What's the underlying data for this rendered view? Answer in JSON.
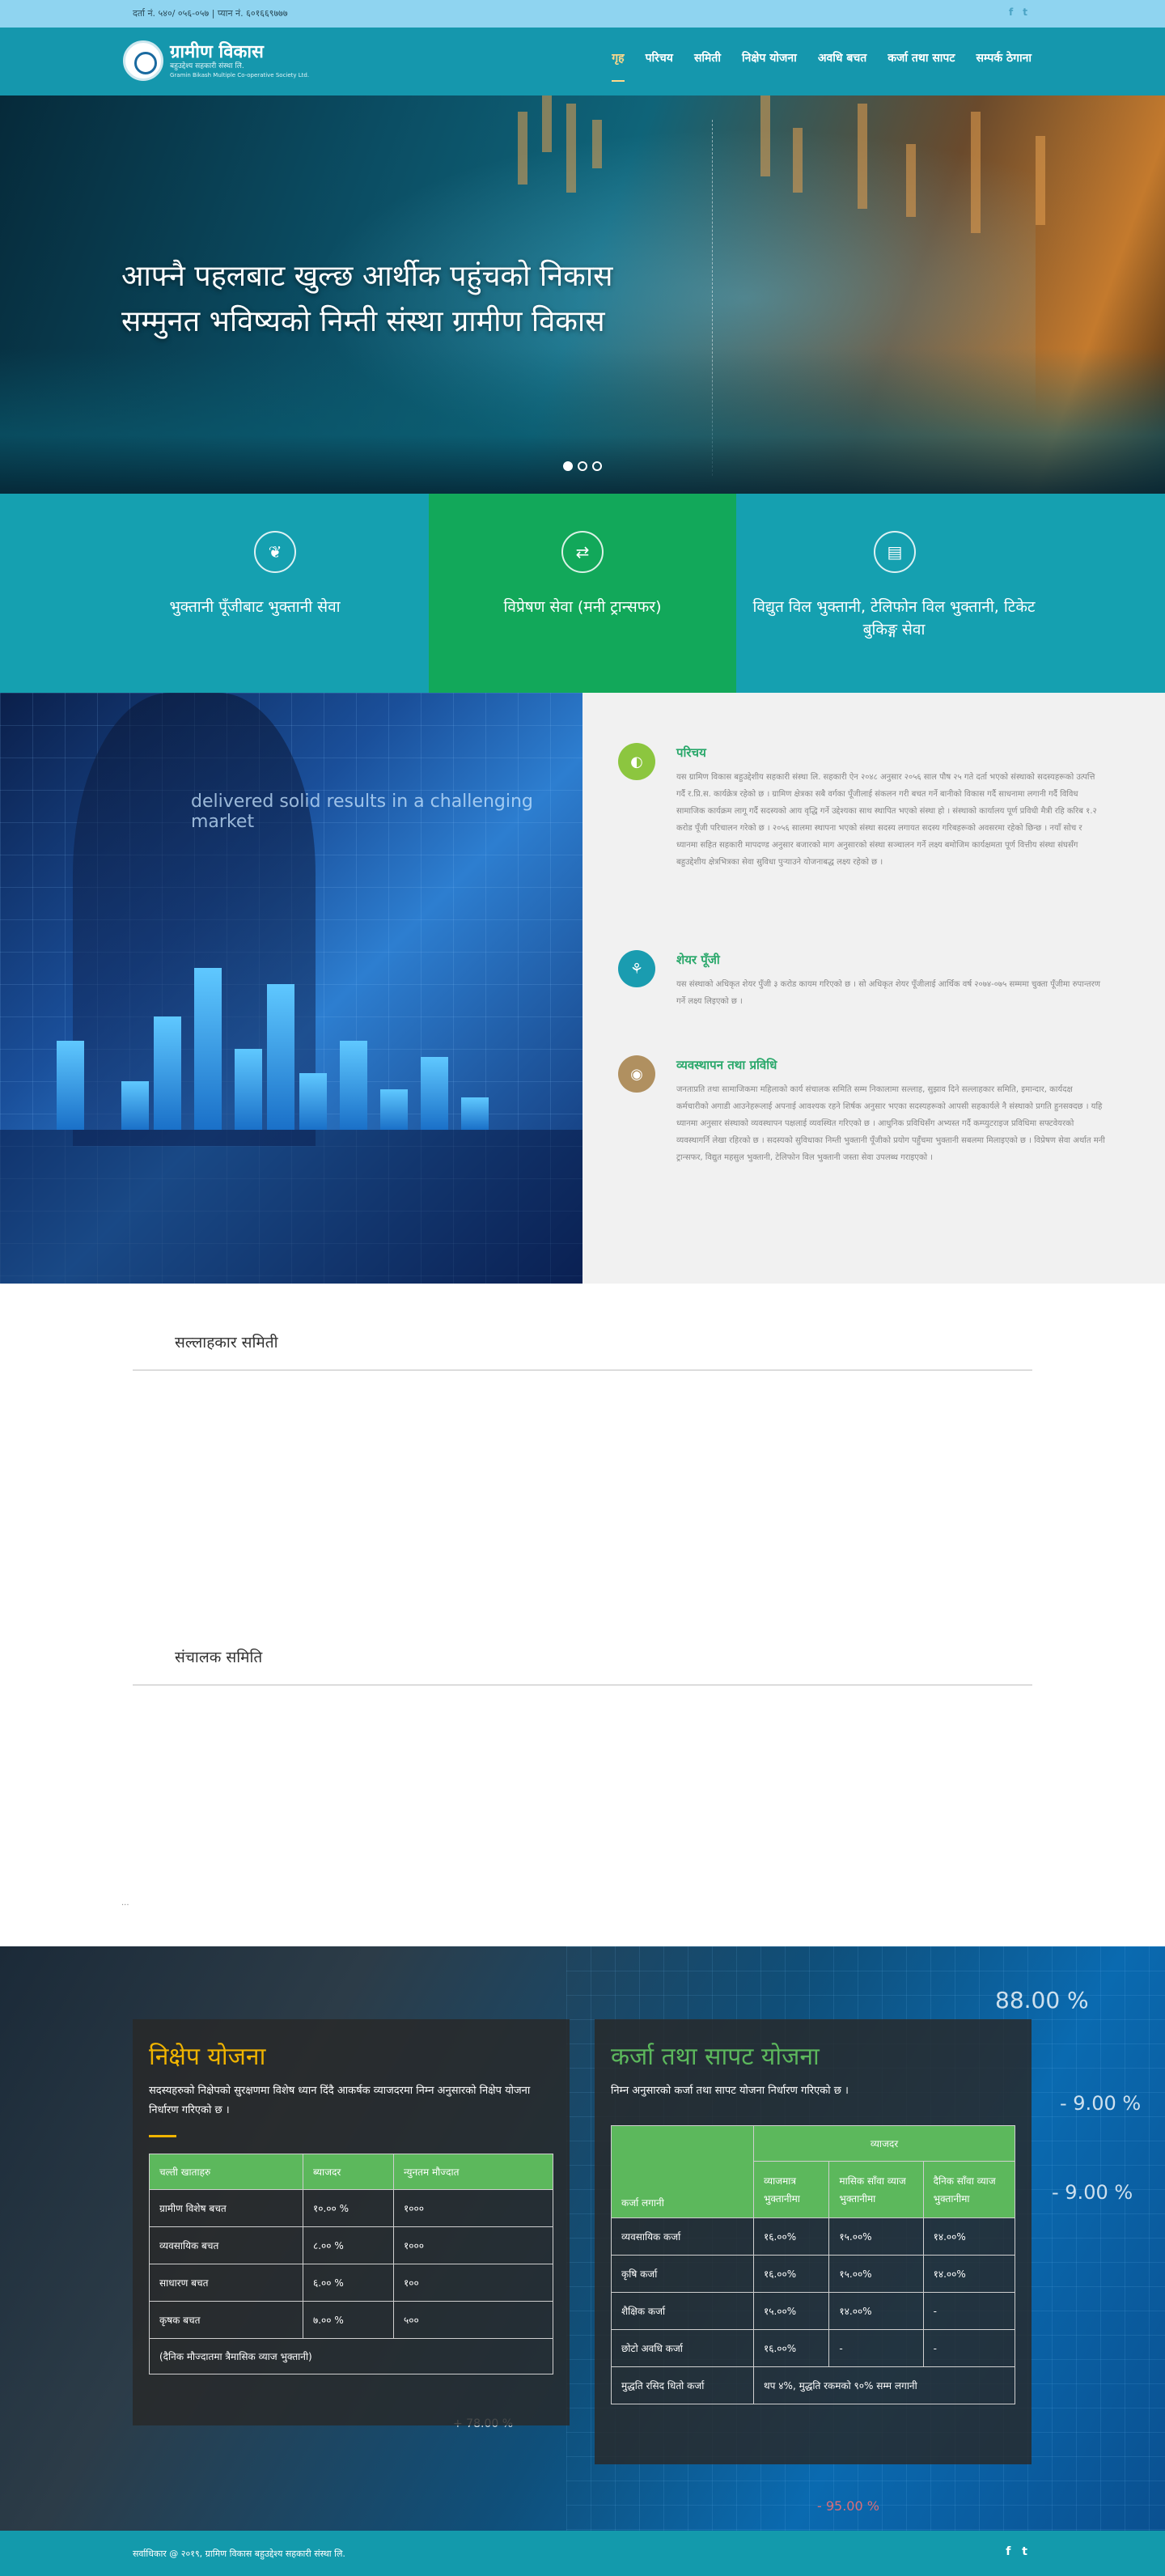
{
  "topbar": {
    "registration": "दर्ता नं. ५४०/ ०५६-०५७ | प्यान नं. ६०१६६९७७७",
    "social": [
      "f",
      "t"
    ]
  },
  "brand": {
    "name": "ग्रामीण विकास",
    "subtitle": "बहुउद्देश्य सहकारी संस्था लि.",
    "subtitle_en": "Gramin Bikash Multiple Co-operative Society Ltd."
  },
  "nav": {
    "items": [
      "गृह",
      "परिचय",
      "समिती",
      "निक्षेप योजना",
      "अवधि बचत",
      "कर्जा तथा सापट",
      "सम्पर्क ठेगाना"
    ],
    "active_index": 0
  },
  "hero": {
    "line1": "आफ्नै पहलबाट खुल्छ आर्थीक पहुंचको निकास",
    "line2": "सम्मुनत भविष्यको निम्ती संस्था ग्रामीण विकास"
  },
  "services": [
    {
      "title": "भुक्तानी पूँजीबाट भुक्तानी सेवा",
      "icon": "leaf-icon"
    },
    {
      "title": "विप्रेषण सेवा (मनी ट्रान्सफर)",
      "icon": "money-transfer-icon"
    },
    {
      "title": "विद्युत विल भुक्तानी, टेलिफोन विल भुक्तानी, टिकेट बुकिङ्ग सेवा",
      "icon": "bill-payment-icon"
    }
  ],
  "about_image": {
    "headline": "delivered solid results in a challenging market"
  },
  "about": [
    {
      "title": "परिचय",
      "icon": "info-icon",
      "color": "#8cc63f",
      "text": "यस ग्रामिण विकास बहुउद्देशीय सहकारी संस्था लि. सहकारी ऐन २०४८ अनुसार २०५६ साल पौष २५ गते दर्ता भएको संस्थाको सदस्यहरूको उत्पत्ति गर्दै र.प्रि.स. कार्यक्रेत्र रहेको छ । ग्रामिण क्षेत्रका सबै वर्गका पूँजीलाई संकलन गरी बचत गर्ने बानीको विकास गर्दै साधनामा लगानी गर्दै विविध सामाजिक कार्यक्रम लागू गर्दै सदस्यको आय वृद्धि गर्ने उद्देश्यका साथ स्थापित भएको संस्था हो । संस्थाको कार्यालय पूर्ण प्रविधी मैत्री रहि करिब १.२ करोड पूँजी परिचालन गरेको छ । २०५६ सालमा स्थापना भएको संस्था सदस्य लगायत सदस्य गरिबहरूको अवसरमा रहेको छिन्छ । नयाँ सोच र ध्यानमा सहित सहकारी मापदण्ड अनुसार बजारको माग अनुसारको संस्था सञ्चालन गर्ने लक्ष्य बमोजिम कार्यक्षमता पूर्ण वित्तीय संस्था संघसँग बहुउद्देशीय क्षेत्रभित्रका सेवा सुविधा पुर्‍याउने योजनाबद्ध लक्ष्य रहेको छ ।"
    },
    {
      "title": "शेयर पूँजी",
      "icon": "share-capital-icon",
      "color": "#1a9cb0",
      "text": "यस संस्थाको अधिकृत शेयर पुँजी ३ करोड कायम गरिएको छ । सो अधिकृत शेयर पूँजीलाई आर्थिक वर्ष २०७४-०७५ सम्ममा चुक्ता पूँजीमा रुपान्तरण गर्ने लक्ष्य लिइएको छ ।"
    },
    {
      "title": "व्यवस्थापन तथा प्रविधि",
      "icon": "management-icon",
      "color": "#b09060",
      "text": "जनताप्रति तथा सामाजिकमा महिलाको कार्य संचालक समिति सम्म निकालामा सल्लाह, सुझाव दिने सल्लाहकार समिति, इमान्दार, कार्यदक्ष कर्मचारीको अगाडी आउनेहरूलाई अपनाई आवश्यक रहने शिर्षक अनुसार भएका सदस्यहरूको आपसी सहकार्यले नै संस्थाको प्रगति हुनसक्दछ । यहि ध्यानमा अनुसार संस्थाको व्यवस्थापन पक्षलाई व्यवस्थित गरिएको छ । आधुनिक प्रविधिसँग अभ्यस्त गर्दै कम्प्युटराइज प्रविधिमा सफ्टवेयरको व्यवस्थागर्नि लेखा रहिरको छ । सदस्यको सुविधाका निम्ती भुक्तानी पूँजीको प्रयोग पहुँचमा भुक्तानी सबलमा मिलाइएको छ । विप्रेषण सेवा अर्थात मनी ट्रान्सफर, विद्युत महसुल भुक्तानी, टेलिफोन विल भुक्तानी जस्ता सेवा उपलब्ध गराइएको ।"
    }
  ],
  "committees": {
    "advisory_title": "सल्लाहकार समिती",
    "board_title": "संचालक समिति",
    "trailing_mark": "..."
  },
  "deposit": {
    "title": "निक्षेप योजना",
    "intro": "सदस्यहरुको निक्षेपको सुरक्षणमा विशेष ध्यान दिंदै आकर्षक व्याजदरमा निम्न अनुसारको निक्षेप योजना निर्धारण गरिएको छ ।",
    "headers": [
      "चल्ती खाताहरु",
      "ब्याजदर",
      "न्युनतम मौज्दात"
    ],
    "rows": [
      [
        "ग्रामीण विशेष बचत",
        "१०.०० %",
        "१०००"
      ],
      [
        "व्यवसायिक बचत",
        "८.०० %",
        "१०००"
      ],
      [
        "साधारण बचत",
        "६.०० %",
        "१००"
      ],
      [
        "कृषक बचत",
        "७.०० %",
        "५००"
      ]
    ],
    "note": "(दैनिक मौज्दातमा त्रैमासिक व्याज भुक्तानी)"
  },
  "loan": {
    "title": "कर्जा तथा सापट योजना",
    "intro": "निम्न अनुसारको कर्जा तथा सापट योजना निर्धारण गरिएको छ ।",
    "col_loan": "कर्जा लगानी",
    "group_header": "व्याजदर",
    "sub_headers": [
      "व्याजमात्र भुक्तानीमा",
      "मासिक साँवा व्याज भुक्तानीमा",
      "दैनिक साँवा व्याज भुक्तानीमा"
    ],
    "rows": [
      [
        "व्यवसायिक कर्जा",
        "१६.००%",
        "१५.००%",
        "१४.००%"
      ],
      [
        "कृषि कर्जा",
        "१६.००%",
        "१५.००%",
        "१४.००%"
      ],
      [
        "शैक्षिक कर्जा",
        "१५.००%",
        "१४.००%",
        "-"
      ],
      [
        "छोटो अवधि कर्जा",
        "१६.००%",
        "-",
        "-"
      ]
    ],
    "last_row": {
      "label": "मुद्धति रसिद धितो कर्जा",
      "value": "थप ४%, मुद्धति रकमको ९०% सम्म लगानी"
    }
  },
  "backdrop_numbers": [
    "88.00 %",
    "- 9.00 %",
    "- 9.00 %",
    "- 95.00 %",
    "+ 78.00 %"
  ],
  "footer": {
    "copyright": "सर्वाधिकार @ २०१९, ग्रामिण विकास बहुउद्देश्य सहकारी संस्था लि.",
    "social": [
      "f",
      "t"
    ]
  },
  "colors": {
    "teal": "#139aac",
    "green": "#12a85a",
    "table_header": "#5cb85c",
    "deposit_title": "#f0b400",
    "loan_title": "#5cb85c"
  }
}
